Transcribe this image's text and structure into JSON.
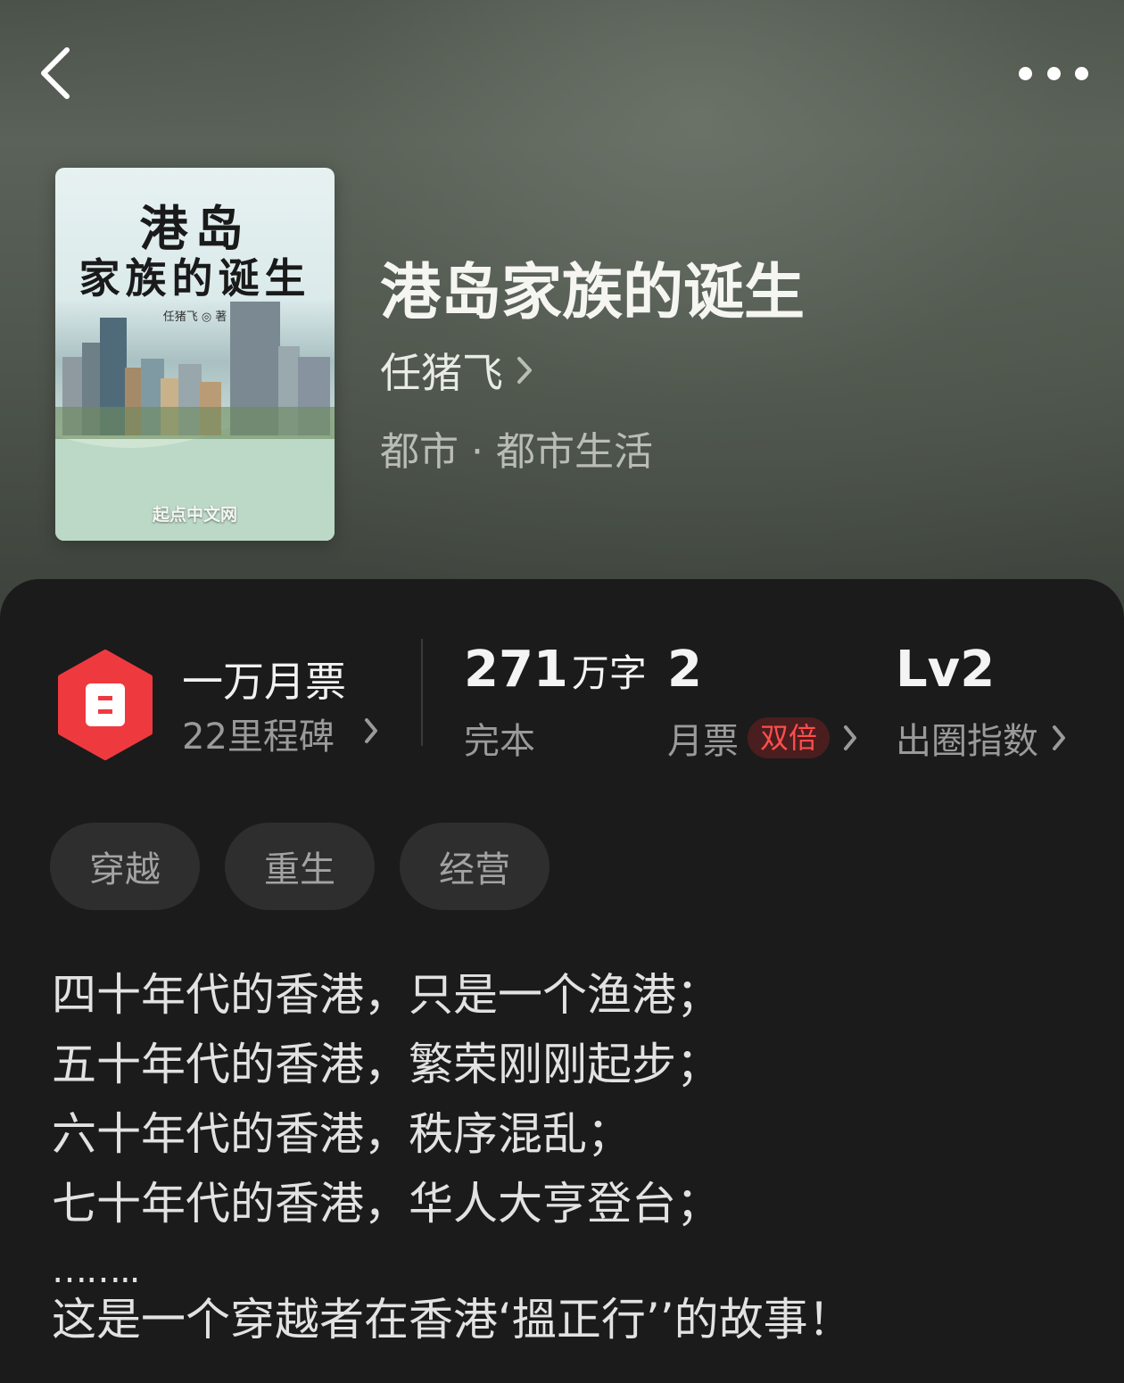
{
  "header": {
    "back_icon": "chevron-left-icon",
    "more_icon": "more-dots-icon"
  },
  "book": {
    "cover": {
      "title_line1": "港岛",
      "title_line2": "家族的诞生",
      "author_line": "任猪飞 ◎ 著",
      "publisher": "起点中文网"
    },
    "title": "港岛家族的诞生",
    "author": "任猪飞",
    "genre": "都市 · 都市生活"
  },
  "award": {
    "title": "一万月票",
    "subtitle": "22里程碑",
    "icon": "ticket-hexagon-icon",
    "accent_color": "#ee3a3f"
  },
  "stats": {
    "words": {
      "value": "271",
      "unit": "万字",
      "label": "完本"
    },
    "monthly_tickets": {
      "value": "2",
      "label": "月票",
      "badge": "双倍"
    },
    "index": {
      "value": "Lv2",
      "label": "出圈指数"
    }
  },
  "tags": [
    "穿越",
    "重生",
    "经营"
  ],
  "description": {
    "lines": [
      "四十年代的香港，只是一个渔港；",
      "五十年代的香港，繁荣刚刚起步；",
      "六十年代的香港，秩序混乱；",
      "七十年代的香港，华人大亨登台；"
    ],
    "ellipsis": "……..",
    "last": "这是一个穿越者在香港‘搵正行’’的故事！"
  }
}
